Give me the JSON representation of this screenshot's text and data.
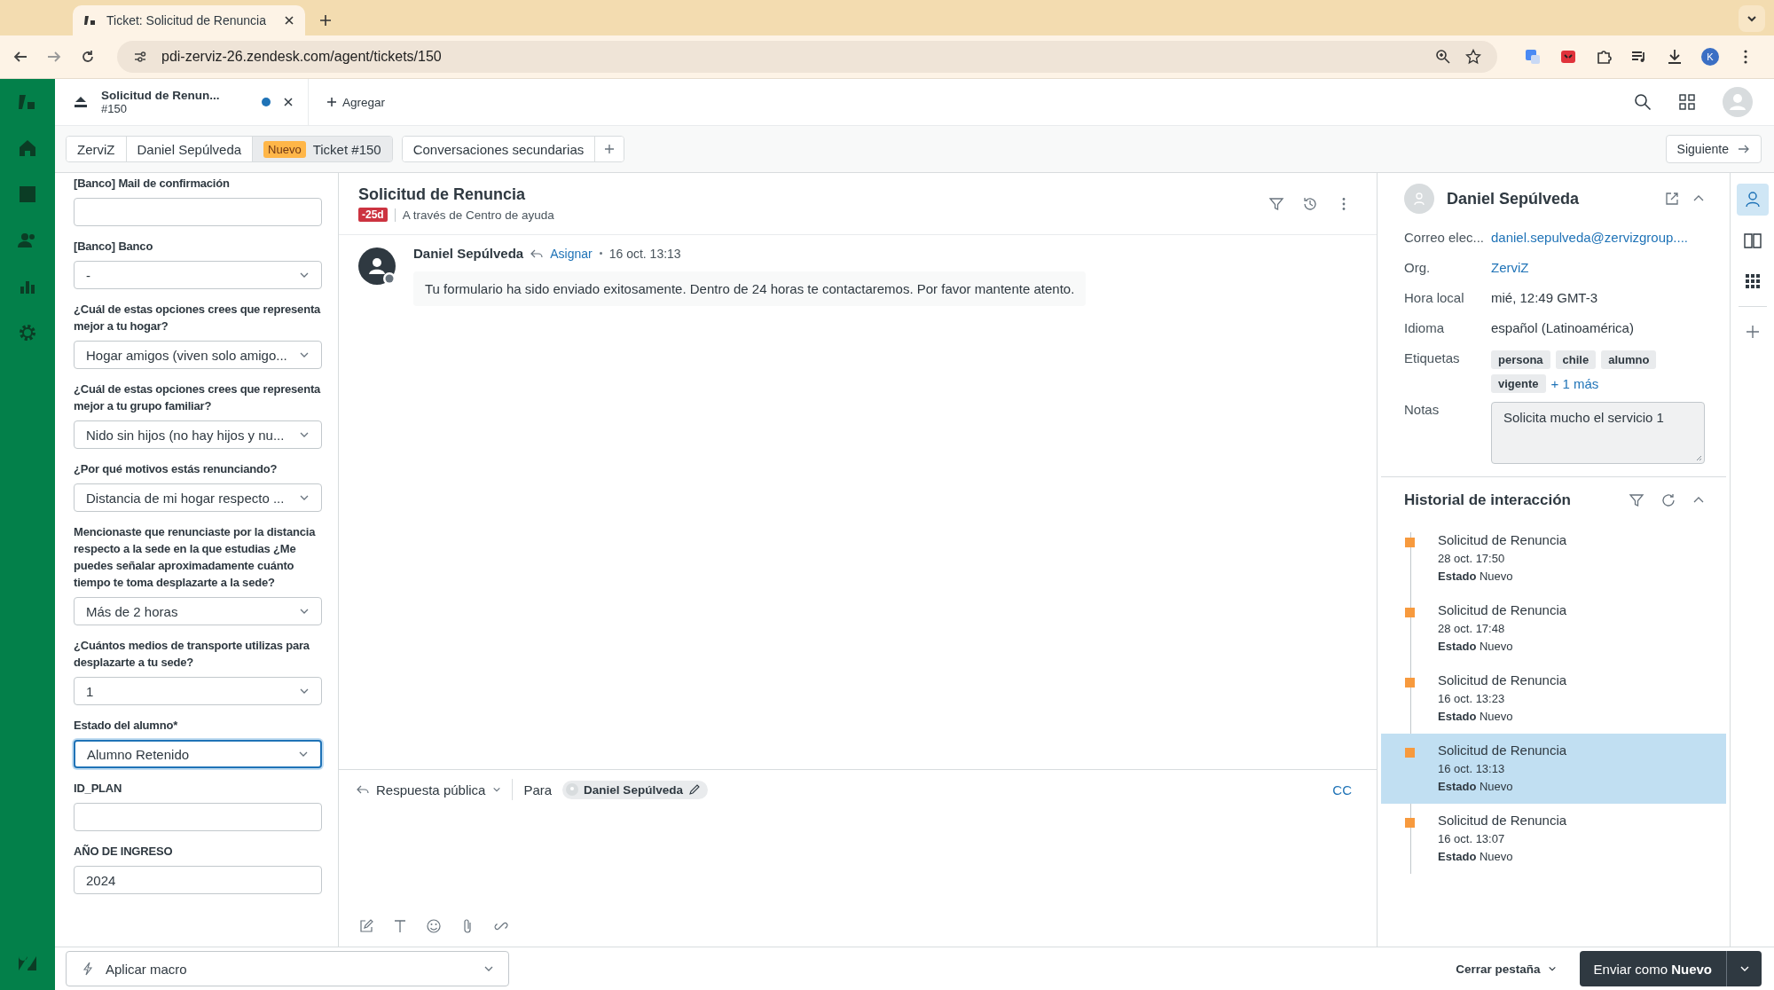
{
  "browser": {
    "tab_title": "Ticket: Solicitud de Renuncia",
    "url": "pdi-zerviz-26.zendesk.com/agent/tickets/150",
    "profile_initial": "K"
  },
  "workspace_tabs": [
    {
      "title": "Solicitud de Renun...",
      "number": "#150",
      "unread": true
    }
  ],
  "add_tab": "Agregar",
  "breadcrumbs": [
    {
      "label": "ZerviZ",
      "selected": false
    },
    {
      "label": "Daniel Sepúlveda",
      "selected": false
    },
    {
      "badge": "Nuevo",
      "label": "Ticket #150",
      "selected": true
    }
  ],
  "side_conversations": "Conversaciones secundarias",
  "next_button": "Siguiente",
  "form_fields": [
    {
      "kind": "text",
      "label": "[Banco] Mail de confirmación",
      "focused": false
    },
    {
      "kind": "select",
      "label": "[Banco] Banco",
      "value": "-",
      "focused": false
    },
    {
      "kind": "select",
      "label": "¿Cuál de estas opciones crees que representa mejor a tu hogar?",
      "value": "Hogar amigos (viven solo amigo...",
      "focused": false
    },
    {
      "kind": "select",
      "label": "¿Cuál de estas opciones crees que representa mejor a tu grupo familiar?",
      "value": "Nido sin hijos (no hay hijos y nu...",
      "focused": false
    },
    {
      "kind": "select",
      "label": "¿Por qué motivos estás renunciando?",
      "value": "Distancia de mi hogar respecto ...",
      "focused": false
    },
    {
      "kind": "select",
      "label": "Mencionaste que renunciaste por la distancia respecto a la sede en la que estudias ¿Me puedes señalar aproximadamente cuánto tiempo te toma desplazarte a la sede?",
      "value": "Más de 2 horas",
      "focused": false
    },
    {
      "kind": "select",
      "label": "¿Cuántos medios de transporte utilizas para desplazarte a tu sede?",
      "value": "1",
      "focused": false
    },
    {
      "kind": "select",
      "label": "Estado del alumno*",
      "value": "Alumno Retenido",
      "focused": true
    },
    {
      "kind": "text",
      "label": "ID_PLAN",
      "focused": false
    },
    {
      "kind": "text",
      "label": "AÑO DE INGRESO",
      "value": "2024",
      "focused": false
    }
  ],
  "ticket": {
    "title": "Solicitud de Renuncia",
    "sla_badge": "-25d",
    "channel": "A través de Centro de ayuda"
  },
  "message": {
    "author": "Daniel Sepúlveda",
    "action": "Asignar",
    "time": "16 oct. 13:13",
    "body": "Tu formulario ha sido enviado exitosamente. Dentro de 24 horas te contactaremos. Por favor mantente atento."
  },
  "composer": {
    "mode": "Respuesta pública",
    "to_label": "Para",
    "recipient": "Daniel Sepúlveda",
    "cc": "CC"
  },
  "user": {
    "name": "Daniel Sepúlveda",
    "fields": [
      {
        "kind": "link",
        "label": "Correo elec...",
        "value": "daniel.sepulveda@zervizgroup...."
      },
      {
        "kind": "link",
        "label": "Org.",
        "value": "ZerviZ"
      },
      {
        "kind": "text",
        "label": "Hora local",
        "value": "mié, 12:49 GMT-3"
      },
      {
        "kind": "text",
        "label": "Idioma",
        "value": "español (Latinoamérica)"
      },
      {
        "kind": "tags",
        "label": "Etiquetas",
        "tags": [
          "persona",
          "chile",
          "alumno",
          "vigente"
        ],
        "more": "+ 1 más"
      },
      {
        "kind": "notes",
        "label": "Notas",
        "value": "Solicita mucho el servicio 1"
      }
    ]
  },
  "history": {
    "title": "Historial de interacción",
    "items": [
      {
        "title": "Solicitud de Renuncia",
        "time": "28 oct. 17:50",
        "status_label": "Estado",
        "status": "Nuevo",
        "selected": false
      },
      {
        "title": "Solicitud de Renuncia",
        "time": "28 oct. 17:48",
        "status_label": "Estado",
        "status": "Nuevo",
        "selected": false
      },
      {
        "title": "Solicitud de Renuncia",
        "time": "16 oct. 13:23",
        "status_label": "Estado",
        "status": "Nuevo",
        "selected": false
      },
      {
        "title": "Solicitud de Renuncia",
        "time": "16 oct. 13:13",
        "status_label": "Estado",
        "status": "Nuevo",
        "selected": true
      },
      {
        "title": "Solicitud de Renuncia",
        "time": "16 oct. 13:07",
        "status_label": "Estado",
        "status": "Nuevo",
        "selected": false
      }
    ]
  },
  "footer": {
    "macro": "Aplicar macro",
    "close_tab": "Cerrar pestaña",
    "submit": "Enviar como **Nuevo**"
  }
}
